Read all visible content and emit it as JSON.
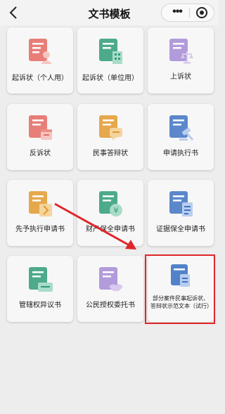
{
  "header": {
    "back_glyph": "<",
    "title": "文书模板",
    "more_glyph": "•••"
  },
  "cards": [
    {
      "label": "起诉状（个人用）",
      "icon": "document-person-icon",
      "color": "#e46a61"
    },
    {
      "label": "起诉状（单位用）",
      "icon": "document-building-icon",
      "color": "#2f9c77"
    },
    {
      "label": "上诉状",
      "icon": "document-scale-icon",
      "color": "#a68bd6"
    },
    {
      "label": "反诉状",
      "icon": "document-calendar-icon",
      "color": "#e46a61"
    },
    {
      "label": "民事答辩状",
      "icon": "document-chat-icon",
      "color": "#e39a2f"
    },
    {
      "label": "申请执行书",
      "icon": "document-gavel-icon",
      "color": "#3f74c3"
    },
    {
      "label": "先予执行申请书",
      "icon": "document-forward-icon",
      "color": "#e39a2f"
    },
    {
      "label": "财产保全申请书",
      "icon": "document-money-icon",
      "color": "#2f9c77"
    },
    {
      "label": "证据保全申请书",
      "icon": "document-file-icon",
      "color": "#3f74c3"
    },
    {
      "label": "管辖权异议书",
      "icon": "document-card-icon",
      "color": "#2f9c77"
    },
    {
      "label": "公民授权委托书",
      "icon": "document-handshake-icon",
      "color": "#a68bd6"
    },
    {
      "label": "部分案件民事起诉状、答辩状示范文本（试行）",
      "icon": "document-sample-icon",
      "color": "#3f74c3"
    }
  ],
  "colors": {
    "highlight": "#e0262a",
    "arrow": "#e0262a"
  }
}
